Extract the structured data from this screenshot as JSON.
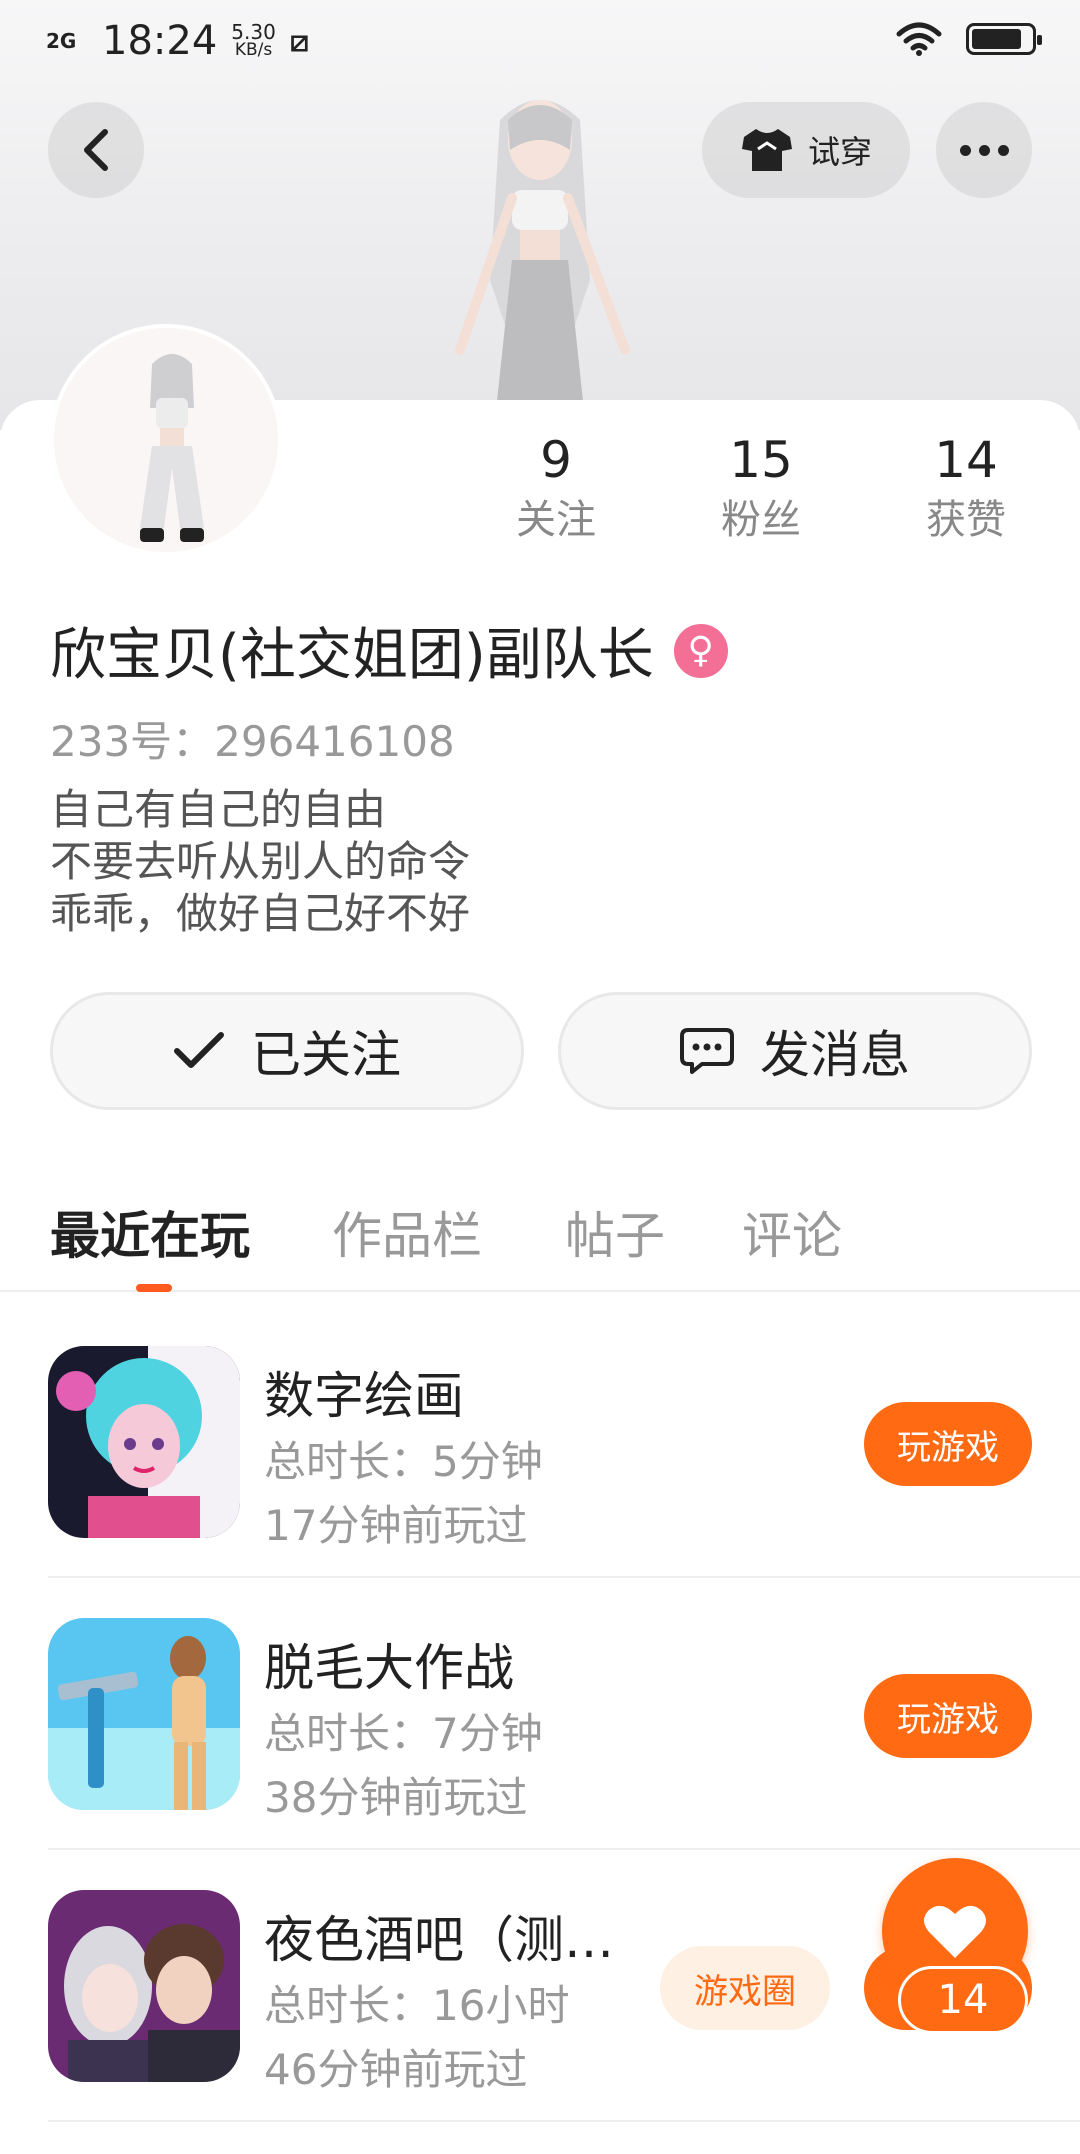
{
  "status_bar": {
    "signal": "2G",
    "time": "18:24",
    "speed_value": "5.30",
    "speed_unit": "KB/s",
    "notification_icon": "sim-s-icon",
    "battery_level": 0.85
  },
  "header": {
    "tryon_label": "试穿"
  },
  "stats": [
    {
      "value": "9",
      "label": "关注"
    },
    {
      "value": "15",
      "label": "粉丝"
    },
    {
      "value": "14",
      "label": "获赞"
    }
  ],
  "profile": {
    "nickname": "欣宝贝(社交姐团)副队长",
    "gender_symbol": "♀",
    "uid": "233号：296416108",
    "bio_lines": [
      "自己有自己的自由",
      "不要去听从别人的命令",
      "乖乖，做好自己好不好"
    ]
  },
  "actions": {
    "following_label": "已关注",
    "message_label": "发消息"
  },
  "tabs": [
    "最近在玩",
    "作品栏",
    "帖子",
    "评论"
  ],
  "games": [
    {
      "title": "数字绘画",
      "duration": "总时长：5分钟",
      "last_played": "17分钟前玩过",
      "button": "玩游戏"
    },
    {
      "title": "脱毛大作战",
      "duration": "总时长：7分钟",
      "last_played": "38分钟前玩过",
      "button": "玩游戏"
    },
    {
      "title": "夜色酒吧（测…",
      "duration": "总时长：16小时",
      "last_played": "46分钟前玩过",
      "button": "游戏圈"
    }
  ],
  "fab": {
    "like_count": "14"
  },
  "colors": {
    "accent": "#ff6a13",
    "gender_pink": "#f36f96",
    "tab_indicator": "#ff5a1f"
  }
}
